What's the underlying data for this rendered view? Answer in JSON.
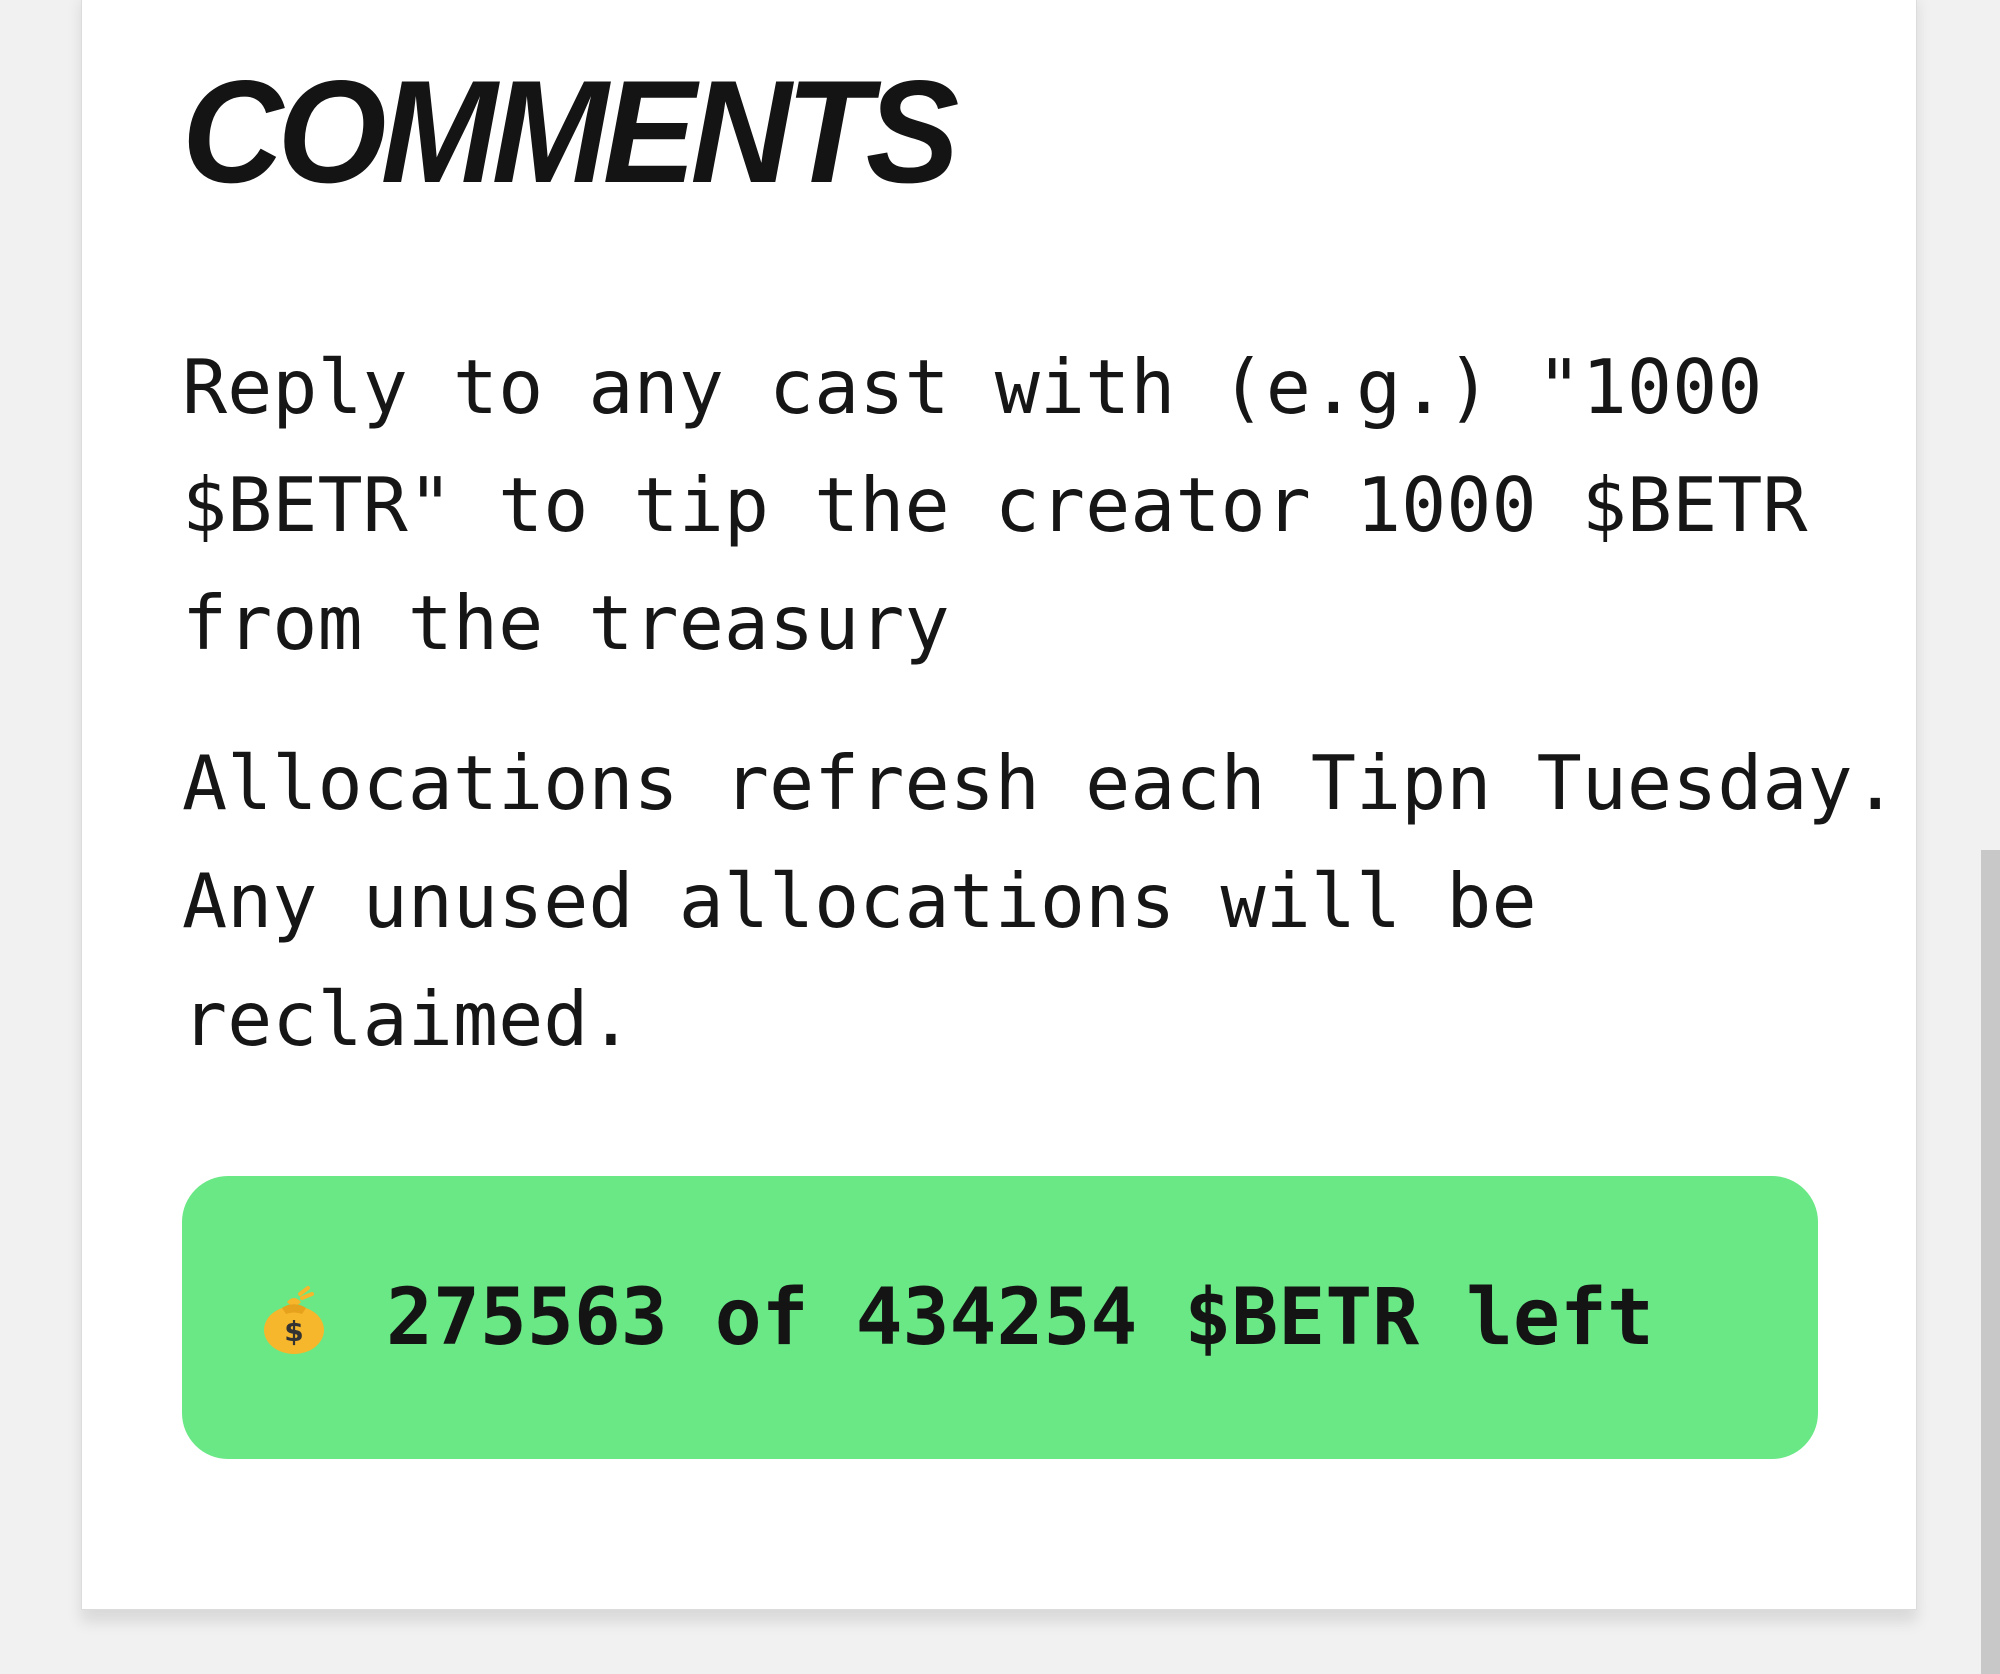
{
  "comments": {
    "heading": "COMMENTS",
    "paragraphs": [
      "Reply to any cast with (e.g.) \"1000 $BETR\" to tip the creator 1000 $BETR from the treasury",
      "Allocations refresh each Tipn Tuesday. Any unused allocations will be reclaimed."
    ],
    "allocation": {
      "icon": "money-bag-icon",
      "text": "275563 of 434254 $BETR left",
      "remaining": 275563,
      "total": 434254,
      "token": "$BETR",
      "background_color": "#69e885"
    }
  }
}
